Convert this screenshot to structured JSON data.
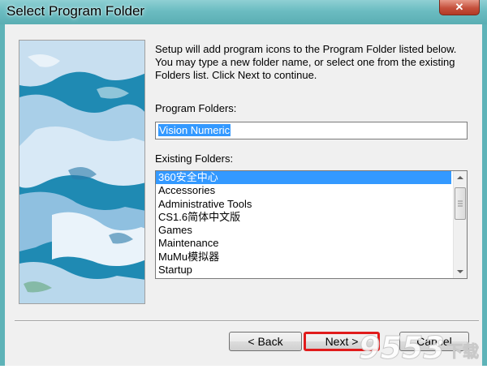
{
  "window": {
    "title": "Select Program Folder",
    "close_label": "✕"
  },
  "description": "Setup will add program icons to the Program Folder listed below. You may type a new folder name, or select one from the existing Folders list.  Click Next to continue.",
  "program_folders": {
    "label": "Program Folders:",
    "value": "Vision Numeric"
  },
  "existing_folders": {
    "label": "Existing Folders:",
    "items": [
      "360安全中心",
      "Accessories",
      "Administrative Tools",
      "CS1.6简体中文版",
      "Games",
      "Maintenance",
      "MuMu模拟器",
      "Startup"
    ],
    "selected_index": 0
  },
  "buttons": {
    "back": "< Back",
    "next": "Next >",
    "cancel": "Cancel"
  },
  "watermark": {
    "text": "9553 下载"
  },
  "colors": {
    "title_bar": "#5eb3b8",
    "selection": "#3399ff",
    "highlight_border": "#e01b1b"
  }
}
